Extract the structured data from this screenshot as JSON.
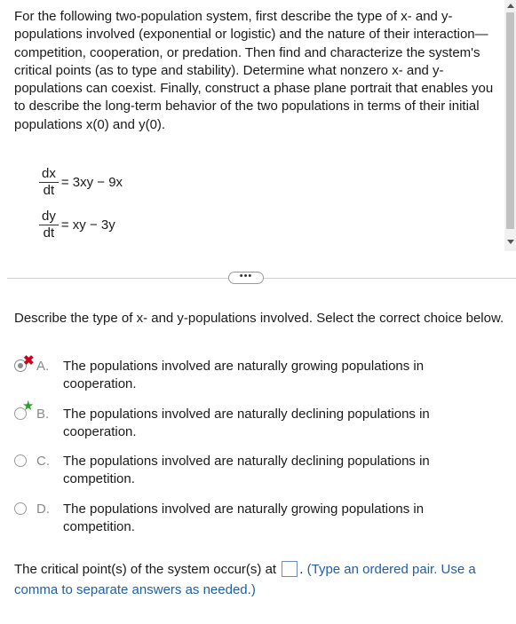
{
  "problem": {
    "text": "For the following two-population system, first describe the type of x- and y-populations involved (exponential or logistic) and the nature of their interaction—competition, cooperation, or predation. Then find and characterize the system's critical points (as to type and stability). Determine what nonzero x- and y-populations can coexist. Finally, construct a phase plane portrait that enables you to describe the long-term behavior of the two populations in terms of their initial populations x(0) and y(0).",
    "eq1": {
      "num": "dx",
      "den": "dt",
      "rhs": "= 3xy − 9x"
    },
    "eq2": {
      "num": "dy",
      "den": "dt",
      "rhs": "= xy − 3y"
    }
  },
  "more_button": "•••",
  "question": "Describe the type of x- and y-populations involved. Select the correct choice below.",
  "choices": [
    {
      "letter": "A.",
      "text": "The populations involved are naturally growing populations in cooperation.",
      "selected": true,
      "mark": "✖"
    },
    {
      "letter": "B.",
      "text": "The populations involved are naturally declining populations in cooperation.",
      "selected": false,
      "mark": "★"
    },
    {
      "letter": "C.",
      "text": "The populations involved are naturally declining populations in competition.",
      "selected": false
    },
    {
      "letter": "D.",
      "text": "The populations involved are naturally growing populations in competition.",
      "selected": false
    }
  ],
  "critical": {
    "prefix": "The critical point(s) of the system occur(s) at",
    "suffix": ".",
    "hint": "(Type an ordered pair. Use a comma to separate answers as needed.)"
  },
  "colors": {
    "wrong": "#d0021b",
    "correct": "#2e9e2e",
    "hint": "#1f5fa8"
  }
}
